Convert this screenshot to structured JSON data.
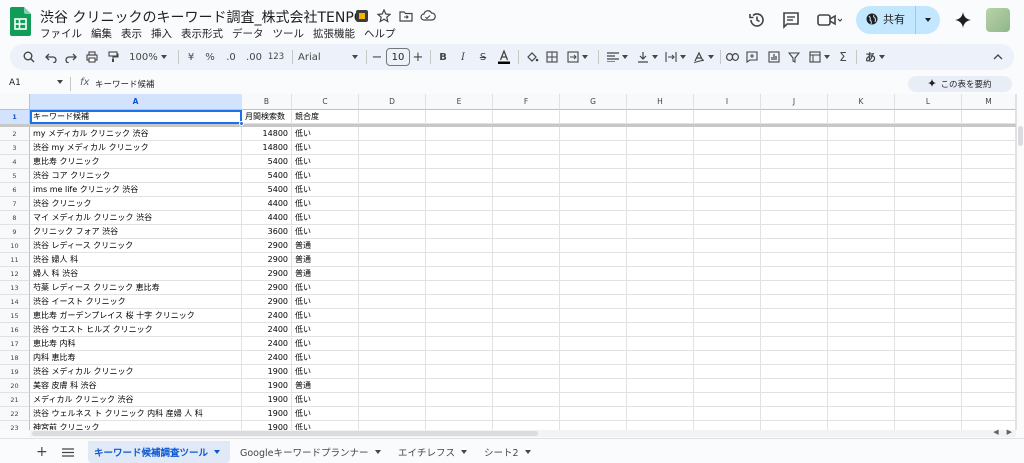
{
  "document": {
    "title": "渋谷 クリニックのキーワード調査_株式会社TENPO"
  },
  "menu": [
    "ファイル",
    "編集",
    "表示",
    "挿入",
    "表示形式",
    "データ",
    "ツール",
    "拡張機能",
    "ヘルプ"
  ],
  "share": {
    "label": "共有"
  },
  "toolbar": {
    "zoom": "100%",
    "currency": "¥",
    "percent": "%",
    "decrease_decimal": ".0",
    "increase_decimal": ".00",
    "number_format": "123",
    "font": "Arial",
    "font_size": "10",
    "input_tools": "あ"
  },
  "formula_bar": {
    "cell_ref": "A1",
    "fx": "fx",
    "value": "キーワード候補",
    "summarize_label": "この表を要約"
  },
  "columns": [
    "A",
    "B",
    "C",
    "D",
    "E",
    "F",
    "G",
    "H",
    "I",
    "J",
    "K",
    "L",
    "M"
  ],
  "rows": [
    {
      "n": "1",
      "a": "キーワード候補",
      "b": "月間検索数",
      "c": "競合度"
    },
    {
      "n": "2",
      "a": "my メディカル クリニック 渋谷",
      "b": "14800",
      "c": "低い"
    },
    {
      "n": "3",
      "a": "渋谷 my メディカル クリニック",
      "b": "14800",
      "c": "低い"
    },
    {
      "n": "4",
      "a": "恵比寿 クリニック",
      "b": "5400",
      "c": "低い"
    },
    {
      "n": "5",
      "a": "渋谷 コア クリニック",
      "b": "5400",
      "c": "低い"
    },
    {
      "n": "6",
      "a": "ims me life クリニック 渋谷",
      "b": "5400",
      "c": "低い"
    },
    {
      "n": "7",
      "a": "渋谷 クリニック",
      "b": "4400",
      "c": "低い"
    },
    {
      "n": "8",
      "a": "マイ メディカル クリニック 渋谷",
      "b": "4400",
      "c": "低い"
    },
    {
      "n": "9",
      "a": "クリニック フォア 渋谷",
      "b": "3600",
      "c": "低い"
    },
    {
      "n": "10",
      "a": "渋谷 レディース クリニック",
      "b": "2900",
      "c": "普通"
    },
    {
      "n": "11",
      "a": "渋谷 婦人 科",
      "b": "2900",
      "c": "普通"
    },
    {
      "n": "12",
      "a": "婦人 科 渋谷",
      "b": "2900",
      "c": "普通"
    },
    {
      "n": "13",
      "a": "芍薬 レディース クリニック 恵比寿",
      "b": "2900",
      "c": "低い"
    },
    {
      "n": "14",
      "a": "渋谷 イースト クリニック",
      "b": "2900",
      "c": "低い"
    },
    {
      "n": "15",
      "a": "恵比寿 ガーデンプレイス 桜 十字 クリニック",
      "b": "2400",
      "c": "低い"
    },
    {
      "n": "16",
      "a": "渋谷 ウエスト ヒルズ クリニック",
      "b": "2400",
      "c": "低い"
    },
    {
      "n": "17",
      "a": "恵比寿 内科",
      "b": "2400",
      "c": "低い"
    },
    {
      "n": "18",
      "a": "内科 恵比寿",
      "b": "2400",
      "c": "低い"
    },
    {
      "n": "19",
      "a": "渋谷 メディカル クリニック",
      "b": "1900",
      "c": "低い"
    },
    {
      "n": "20",
      "a": "美容 皮膚 科 渋谷",
      "b": "1900",
      "c": "普通"
    },
    {
      "n": "21",
      "a": "メディカル クリニック 渋谷",
      "b": "1900",
      "c": "低い"
    },
    {
      "n": "22",
      "a": "渋谷 ウェルネス ト クリニック 内科 産婦 人 科",
      "b": "1900",
      "c": "低い"
    },
    {
      "n": "23",
      "a": "神宮前 クリニック",
      "b": "1900",
      "c": "低い"
    }
  ],
  "sheets": [
    {
      "label": "キーワード候補調査ツール",
      "active": true
    },
    {
      "label": "Googleキーワードプランナー",
      "active": false
    },
    {
      "label": "エイチレフス",
      "active": false
    },
    {
      "label": "シート2",
      "active": false
    }
  ],
  "colors": {
    "sheets_green": "#0f9d58",
    "share_bg": "#c2e7ff",
    "selection_blue": "#1a73e8"
  }
}
